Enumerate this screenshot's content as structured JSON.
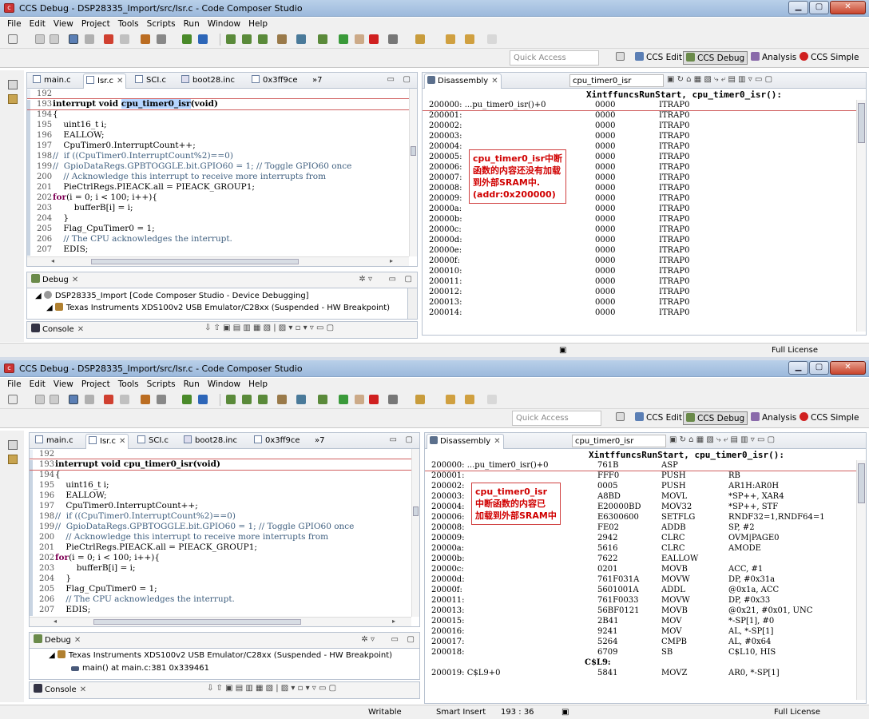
{
  "colors": {
    "accent": "#b5d5ff",
    "annotation": "#d00000",
    "titlebar": "#9cb9dc"
  },
  "menu": [
    "File",
    "Edit",
    "View",
    "Project",
    "Tools",
    "Scripts",
    "Run",
    "Window",
    "Help"
  ],
  "quick_access": "Quick Access",
  "perspectives": [
    {
      "label": "CCS Edit",
      "icon": "ccs-edit-icon"
    },
    {
      "label": "CCS Debug",
      "icon": "ccs-debug-icon",
      "active": true
    },
    {
      "label": "Analysis",
      "icon": "analysis-icon"
    },
    {
      "label": "CCS Simple",
      "icon": "ccs-simple-icon"
    }
  ],
  "w1": {
    "title": "CCS Debug - DSP28335_Import/src/Isr.c - Code Composer Studio",
    "editor_tabs": [
      "main.c",
      "Isr.c",
      "SCI.c",
      "boot28.inc",
      "0x3ff9ce"
    ],
    "more_tabs": "»7",
    "code": [
      {
        "n": "192",
        "t": ""
      },
      {
        "n": "193",
        "pre": "interrupt void ",
        "hl": "cpu_timer0_isr",
        "post": "(void)"
      },
      {
        "n": "194",
        "t": "{"
      },
      {
        "n": "195",
        "t": "    uint16_t i;"
      },
      {
        "n": "196",
        "t": "    EALLOW;"
      },
      {
        "n": "197",
        "t": "    CpuTimer0.InterruptCount++;"
      },
      {
        "n": "198",
        "t": "//  if ((CpuTimer0.InterruptCount%2)==0)",
        "c": true
      },
      {
        "n": "199",
        "t": "//  GpioDataRegs.GPBTOGGLE.bit.GPIO60 = 1; // Toggle GPIO60 once",
        "c": true
      },
      {
        "n": "200",
        "t": "    // Acknowledge this interrupt to receive more interrupts from",
        "c": true
      },
      {
        "n": "201",
        "t": "    PieCtrlRegs.PIEACK.all = PIEACK_GROUP1;"
      },
      {
        "n": "202",
        "kw": "for",
        "t": "(i = 0; i < 100; i++){"
      },
      {
        "n": "203",
        "t": "        bufferB[i] = i;"
      },
      {
        "n": "204",
        "t": "    }"
      },
      {
        "n": "205",
        "t": "    Flag_CpuTimer0 = 1;"
      },
      {
        "n": "206",
        "t": "    // The CPU acknowledges the interrupt.",
        "c": true
      },
      {
        "n": "207",
        "t": "    EDIS;"
      }
    ],
    "debug_tab": "Debug",
    "debug_tree": [
      {
        "t": "DSP28335_Import [Code Composer Studio - Device Debugging]",
        "i": "debug-session-icon"
      },
      {
        "t": "Texas Instruments XDS100v2 USB Emulator/C28xx (Suspended - HW Breakpoint)",
        "i": "emulator-icon"
      }
    ],
    "console_tab": "Console",
    "dis_tab": "Disassembly",
    "dis_location": "cpu_timer0_isr",
    "dis_header": "XintffuncsRunStart, cpu_timer0_isr():",
    "dis_rows": [
      [
        "200000: ...pu_timer0_isr()+0",
        "0000",
        "ITRAP0",
        ""
      ],
      [
        "200001:",
        "0000",
        "ITRAP0",
        ""
      ],
      [
        "200002:",
        "0000",
        "ITRAP0",
        ""
      ],
      [
        "200003:",
        "0000",
        "ITRAP0",
        ""
      ],
      [
        "200004:",
        "0000",
        "ITRAP0",
        ""
      ],
      [
        "200005:",
        "0000",
        "ITRAP0",
        ""
      ],
      [
        "200006:",
        "0000",
        "ITRAP0",
        ""
      ],
      [
        "200007:",
        "0000",
        "ITRAP0",
        ""
      ],
      [
        "200008:",
        "0000",
        "ITRAP0",
        ""
      ],
      [
        "200009:",
        "0000",
        "ITRAP0",
        ""
      ],
      [
        "20000a:",
        "0000",
        "ITRAP0",
        ""
      ],
      [
        "20000b:",
        "0000",
        "ITRAP0",
        ""
      ],
      [
        "20000c:",
        "0000",
        "ITRAP0",
        ""
      ],
      [
        "20000d:",
        "0000",
        "ITRAP0",
        ""
      ],
      [
        "20000e:",
        "0000",
        "ITRAP0",
        ""
      ],
      [
        "20000f:",
        "0000",
        "ITRAP0",
        ""
      ],
      [
        "200010:",
        "0000",
        "ITRAP0",
        ""
      ],
      [
        "200011:",
        "0000",
        "ITRAP0",
        ""
      ],
      [
        "200012:",
        "0000",
        "ITRAP0",
        ""
      ],
      [
        "200013:",
        "0000",
        "ITRAP0",
        ""
      ],
      [
        "200014:",
        "0000",
        "ITRAP0",
        ""
      ]
    ],
    "annotation": "cpu_timer0_isr中断\n函数的内容还没有加载\n到外部SRAM中.\n(addr:0x200000)",
    "status": [
      "Full License"
    ]
  },
  "w2": {
    "title": "CCS Debug - DSP28335_Import/src/Isr.c - Code Composer Studio",
    "editor_tabs": [
      "main.c",
      "Isr.c",
      "SCI.c",
      "boot28.inc",
      "0x3ff9ce"
    ],
    "more_tabs": "»7",
    "code": [
      {
        "n": "192",
        "t": ""
      },
      {
        "n": "193",
        "pre": "interrupt void ",
        "hl": "",
        "post": "cpu_timer0_isr(void)"
      },
      {
        "n": "194",
        "t": "{"
      },
      {
        "n": "195",
        "t": "    uint16_t i;"
      },
      {
        "n": "196",
        "t": "    EALLOW;"
      },
      {
        "n": "197",
        "t": "    CpuTimer0.InterruptCount++;"
      },
      {
        "n": "198",
        "t": "//  if ((CpuTimer0.InterruptCount%2)==0)",
        "c": true
      },
      {
        "n": "199",
        "t": "//  GpioDataRegs.GPBTOGGLE.bit.GPIO60 = 1; // Toggle GPIO60 once",
        "c": true
      },
      {
        "n": "200",
        "t": "    // Acknowledge this interrupt to receive more interrupts from",
        "c": true
      },
      {
        "n": "201",
        "t": "    PieCtrlRegs.PIEACK.all = PIEACK_GROUP1;"
      },
      {
        "n": "202",
        "kw": "for",
        "t": "(i = 0; i < 100; i++){"
      },
      {
        "n": "203",
        "t": "        bufferB[i] = i;"
      },
      {
        "n": "204",
        "t": "    }"
      },
      {
        "n": "205",
        "t": "    Flag_CpuTimer0 = 1;"
      },
      {
        "n": "206",
        "t": "    // The CPU acknowledges the interrupt.",
        "c": true
      },
      {
        "n": "207",
        "t": "    EDIS;"
      }
    ],
    "debug_tab": "Debug",
    "debug_tree": [
      {
        "t": "Texas Instruments XDS100v2 USB Emulator/C28xx (Suspended - HW Breakpoint)",
        "i": "emulator-icon"
      },
      {
        "t": "main() at main.c:381 0x339461",
        "i": "stack-frame-icon"
      }
    ],
    "console_tab": "Console",
    "dis_tab": "Disassembly",
    "dis_location": "cpu_timer0_isr",
    "dis_header": "XintffuncsRunStart, cpu_timer0_isr():",
    "dis_rows": [
      [
        "200000: ...pu_timer0_isr()+0",
        "761B",
        "ASP",
        ""
      ],
      [
        "200001:",
        "FFF0",
        "PUSH",
        "RB"
      ],
      [
        "200002:",
        "0005",
        "PUSH",
        "AR1H:AR0H"
      ],
      [
        "200003:",
        "A8BD",
        "MOVL",
        "*SP++, XAR4"
      ],
      [
        "200004:",
        "E20000BD",
        "MOV32",
        "*SP++, STF"
      ],
      [
        "200006:",
        "E6300600",
        "SETFLG",
        "RNDF32=1,RNDF64=1"
      ],
      [
        "200008:",
        "FE02",
        "ADDB",
        "SP, #2"
      ],
      [
        "200009:",
        "2942",
        "CLRC",
        "OVM|PAGE0"
      ],
      [
        "20000a:",
        "5616",
        "CLRC",
        "AMODE"
      ],
      [
        "20000b:",
        "7622",
        "EALLOW",
        ""
      ],
      [
        "20000c:",
        "0201",
        "MOVB",
        "ACC, #1"
      ],
      [
        "20000d:",
        "761F031A",
        "MOVW",
        "DP, #0x31a"
      ],
      [
        "20000f:",
        "5601001A",
        "ADDL",
        "@0x1a, ACC"
      ],
      [
        "200011:",
        "761F0033",
        "MOVW",
        "DP, #0x33"
      ],
      [
        "200013:",
        "56BF0121",
        "MOVB",
        "@0x21, #0x01, UNC"
      ],
      [
        "200015:",
        "2B41",
        "MOV",
        "*-SP[1], #0"
      ],
      [
        "200016:",
        "9241",
        "MOV",
        "AL, *-SP[1]"
      ],
      [
        "200017:",
        "5264",
        "CMPB",
        "AL, #0x64"
      ],
      [
        "200018:",
        "6709",
        "SB",
        "C$L10, HIS"
      ],
      [
        "C$L9:",
        "",
        "",
        ""
      ],
      [
        "200019: C$L9+0",
        "5841",
        "MOVZ",
        "AR0, *-SP[1]"
      ]
    ],
    "annotation": "cpu_timer0_isr\n中断函数的内容已\n加载到外部SRAM中",
    "status": [
      "Writable",
      "Smart Insert",
      "193 : 36",
      "Full License"
    ]
  }
}
